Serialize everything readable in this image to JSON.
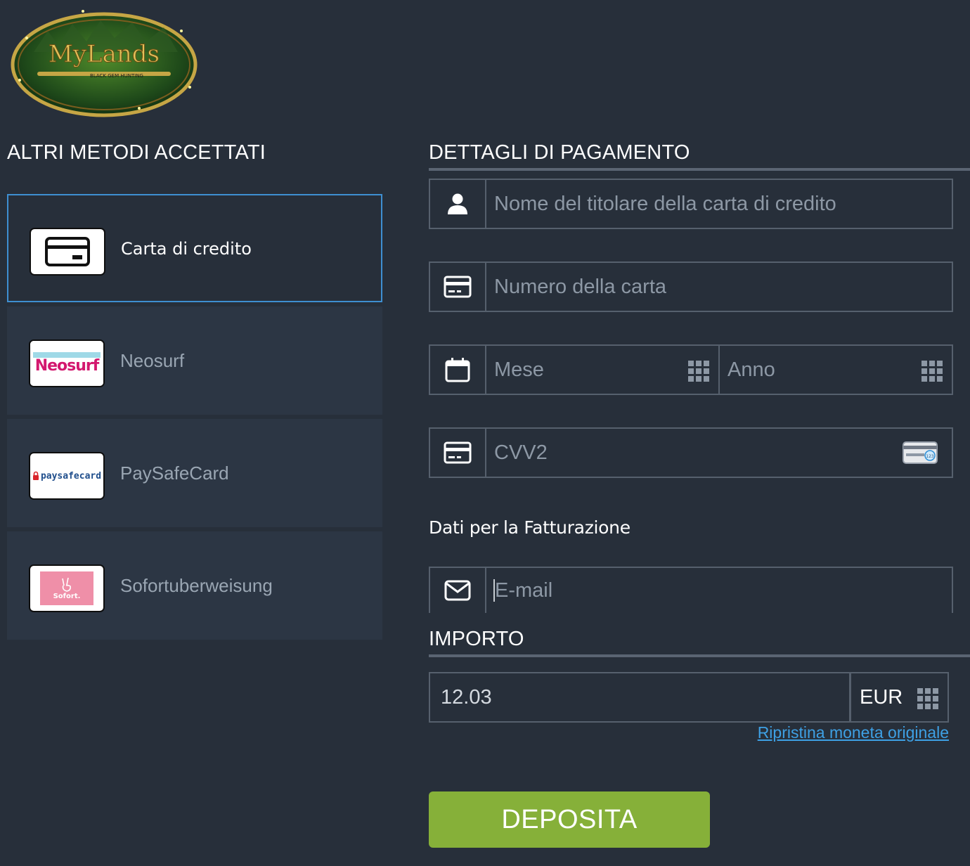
{
  "brand": {
    "logo_text": "MyLands",
    "logo_tagline": "BLACK GEM HUNTING"
  },
  "left": {
    "title": "ALTRI METODI ACCETTATI",
    "methods": [
      {
        "label": "Carta di credito",
        "icon": "credit-card-icon",
        "active": true
      },
      {
        "label": "Neosurf",
        "logo_text": "Neosurf",
        "active": false
      },
      {
        "label": "PaySafeCard",
        "logo_text": "paysafecard",
        "active": false
      },
      {
        "label": "Sofortuberweisung",
        "logo_text": "Sofort.",
        "active": false
      }
    ]
  },
  "payment": {
    "title": "DETTAGLI DI PAGAMENTO",
    "holder_placeholder": "Nome del titolare della carta di credito",
    "card_number_placeholder": "Numero della carta",
    "month_placeholder": "Mese",
    "year_placeholder": "Anno",
    "cvv_placeholder": "CVV2",
    "cvv_badge": "123"
  },
  "billing": {
    "title": "Dati per la Fatturazione",
    "email_placeholder": "E-mail"
  },
  "amount": {
    "title": "IMPORTO",
    "value": "12.03",
    "currency": "EUR",
    "restore_link": "Ripristina moneta originale"
  },
  "deposit_label": "DEPOSITA",
  "colors": {
    "background": "#272f3a",
    "panel": "#2c3644",
    "border": "#56606d",
    "active_border": "#3e8fd1",
    "link": "#3ea0e4",
    "deposit": "#86b039"
  }
}
